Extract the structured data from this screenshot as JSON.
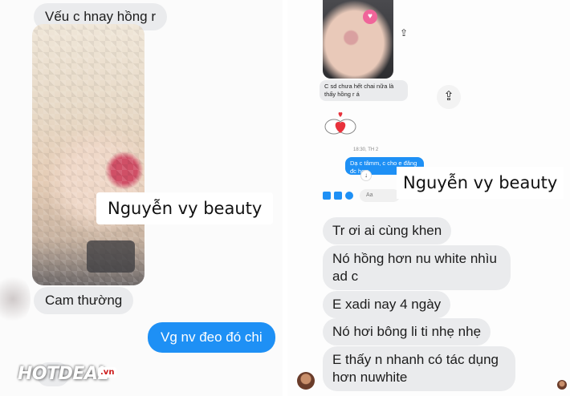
{
  "left_chat": {
    "msg_top": "Vếu c hnay hồng r",
    "msg_mid": "Cam thường",
    "msg_sent": "Vg nv đeo đó chi",
    "watermark": "Nguyễn vy beauty",
    "logo_text": "HOTDEAL",
    "logo_suffix": ".vn"
  },
  "right_chat": {
    "small_msg": "C sd chưa hết chai nữa là thấy hồng r á",
    "timestamp": "18:30, TH 2",
    "small_sent": "Dạ c tâmm, c cho e đăng đc hơn",
    "composer_placeholder": "Aa",
    "watermark": "Nguyễn vy beauty",
    "messages": [
      "Tr ơi ai cùng khen",
      "Nó hồng hơn nu white nhìu ad c",
      "E xadi nay 4 ngày",
      "Nó hơi bông li ti nhẹ nhẹ",
      "E thấy n nhanh có tác dụng hơn nuwhite"
    ]
  },
  "icons": {
    "share": "share-icon",
    "scroll_down": "arrow-down-icon",
    "heart_sticker": "heart-sticker-icon"
  },
  "colors": {
    "incoming_bubble": "#eaebed",
    "outgoing_bubble": "#1e90f5"
  }
}
